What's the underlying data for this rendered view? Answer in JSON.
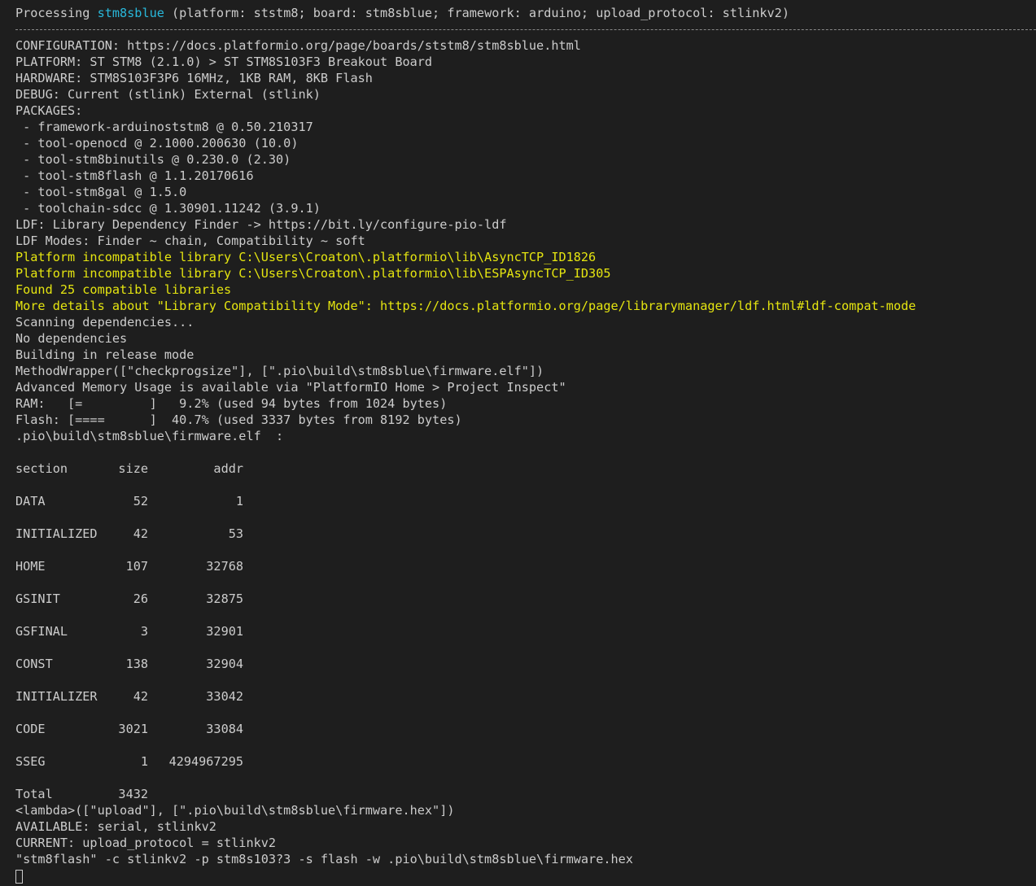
{
  "header": {
    "prefix": "Processing ",
    "env_name": "stm8sblue",
    "suffix": " (platform: ststm8; board: stm8sblue; framework: arduino; upload_protocol: stlinkv2)"
  },
  "info_lines": [
    "CONFIGURATION: https://docs.platformio.org/page/boards/ststm8/stm8sblue.html",
    "PLATFORM: ST STM8 (2.1.0) > ST STM8S103F3 Breakout Board",
    "HARDWARE: STM8S103F3P6 16MHz, 1KB RAM, 8KB Flash",
    "DEBUG: Current (stlink) External (stlink)",
    "PACKAGES:",
    " - framework-arduinoststm8 @ 0.50.210317",
    " - tool-openocd @ 2.1000.200630 (10.0)",
    " - tool-stm8binutils @ 0.230.0 (2.30)",
    " - tool-stm8flash @ 1.1.20170616",
    " - tool-stm8gal @ 1.5.0",
    " - toolchain-sdcc @ 1.30901.11242 (3.9.1)",
    "LDF: Library Dependency Finder -> https://bit.ly/configure-pio-ldf",
    "LDF Modes: Finder ~ chain, Compatibility ~ soft"
  ],
  "warning_lines": [
    "Platform incompatible library C:\\Users\\Croaton\\.platformio\\lib\\AsyncTCP_ID1826",
    "Platform incompatible library C:\\Users\\Croaton\\.platformio\\lib\\ESPAsyncTCP_ID305",
    "Found 25 compatible libraries",
    "More details about \"Library Compatibility Mode\": https://docs.platformio.org/page/librarymanager/ldf.html#ldf-compat-mode"
  ],
  "build_lines": [
    "Scanning dependencies...",
    "No dependencies",
    "Building in release mode",
    "MethodWrapper([\"checkprogsize\"], [\".pio\\build\\stm8sblue\\firmware.elf\"])",
    "Advanced Memory Usage is available via \"PlatformIO Home > Project Inspect\"",
    "RAM:   [=         ]   9.2% (used 94 bytes from 1024 bytes)",
    "Flash: [====      ]  40.7% (used 3337 bytes from 8192 bytes)",
    ".pio\\build\\stm8sblue\\firmware.elf  :"
  ],
  "sections_table": {
    "headers": [
      "section",
      "size",
      "addr"
    ],
    "rows": [
      [
        "DATA",
        "52",
        "1"
      ],
      [
        "INITIALIZED",
        "42",
        "53"
      ],
      [
        "HOME",
        "107",
        "32768"
      ],
      [
        "GSINIT",
        "26",
        "32875"
      ],
      [
        "GSFINAL",
        "3",
        "32901"
      ],
      [
        "CONST",
        "138",
        "32904"
      ],
      [
        "INITIALIZER",
        "42",
        "33042"
      ],
      [
        "CODE",
        "3021",
        "33084"
      ],
      [
        "SSEG",
        "1",
        "4294967295"
      ]
    ],
    "total_label": "Total",
    "total_value": "3432"
  },
  "upload_lines": [
    "<lambda>([\"upload\"], [\".pio\\build\\stm8sblue\\firmware.hex\"])",
    "AVAILABLE: serial, stlinkv2",
    "CURRENT: upload_protocol = stlinkv2",
    "\"stm8flash\" -c stlinkv2 -p stm8s103?3 -s flash -w .pio\\build\\stm8sblue\\firmware.hex"
  ],
  "colors": {
    "background": "#1e1e1e",
    "text": "#cccccc",
    "highlight": "#29b8db",
    "warning": "#e5e510"
  }
}
